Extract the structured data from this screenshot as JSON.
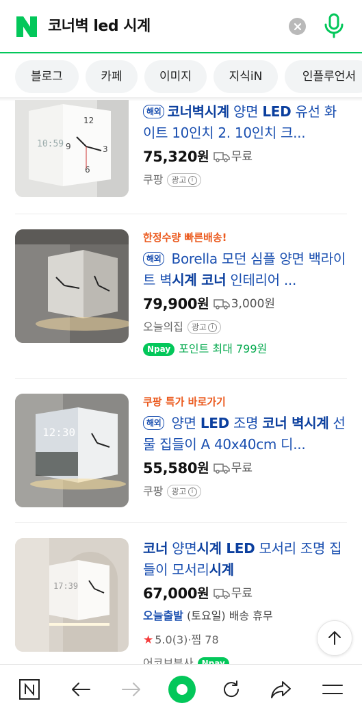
{
  "search": {
    "query": "코너벽 led 시계",
    "brand_color": "#03c75a"
  },
  "tabs": [
    {
      "label": "블로그"
    },
    {
      "label": "카페"
    },
    {
      "label": "이미지"
    },
    {
      "label": "지식iN"
    },
    {
      "label": "인플루언서"
    }
  ],
  "results": [
    {
      "overseas_badge": "해외",
      "title_bold_1": "코너벽시계",
      "title_rest_1": " 양면 ",
      "title_bold_2": "LED",
      "title_rest_2": " 유선 화이트 10인치 2. 10인치 크...",
      "price": "75,320",
      "currency": "원",
      "shipping": "무료",
      "seller": "쿠팡",
      "ad_label": "광고",
      "ad_info": "i"
    },
    {
      "promo": "한정수량 빠른배송!",
      "overseas_badge": "해외",
      "title_rest_1": " Borella 모던 심플 양면 백라이트 벽",
      "title_bold_1": "시계 코너",
      "title_rest_2": " 인테리어 ...",
      "price": "79,900",
      "currency": "원",
      "shipping": "3,000원",
      "seller": "오늘의집",
      "ad_label": "광고",
      "ad_info": "i",
      "npay_label": "pay",
      "npay_text": "포인트 최대 799원"
    },
    {
      "promo": "쿠팡 특가 바로가기",
      "overseas_badge": "해외",
      "title_rest_1": " 양면 ",
      "title_bold_1": "LED",
      "title_rest_2": " 조명 ",
      "title_bold_2": "코너 벽시계",
      "title_rest_3": " 선물 집들이 A 40x40cm 디...",
      "price": "55,580",
      "currency": "원",
      "shipping": "무료",
      "seller": "쿠팡",
      "ad_label": "광고",
      "ad_info": "i"
    },
    {
      "title_bold_1": "코너",
      "title_rest_1": " 양면",
      "title_bold_2": "시계 LED",
      "title_rest_2": " 모서리 조명 집들이 모서리",
      "title_bold_3": "시계",
      "price": "67,000",
      "currency": "원",
      "shipping": "무료",
      "today_label": "오늘출발",
      "today_text": " (토요일) 배송 휴무",
      "rating": "5.0",
      "rating_count": "(3)",
      "sep": " · ",
      "wishlist": "찜 78",
      "seller_partial": "어코브부사",
      "npay_label": "pay"
    }
  ]
}
